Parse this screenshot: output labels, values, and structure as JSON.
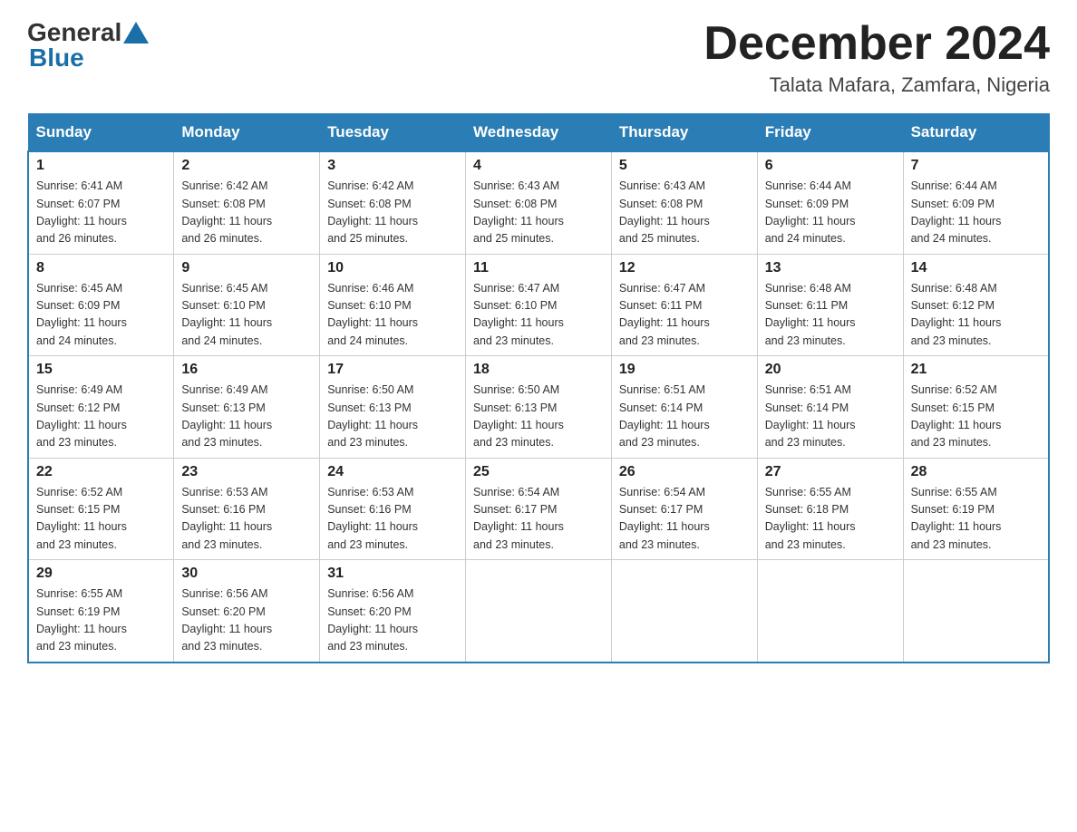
{
  "header": {
    "logo_general": "General",
    "logo_blue": "Blue",
    "month_title": "December 2024",
    "location": "Talata Mafara, Zamfara, Nigeria"
  },
  "weekdays": [
    "Sunday",
    "Monday",
    "Tuesday",
    "Wednesday",
    "Thursday",
    "Friday",
    "Saturday"
  ],
  "weeks": [
    [
      {
        "day": "1",
        "sunrise": "6:41 AM",
        "sunset": "6:07 PM",
        "daylight": "11 hours and 26 minutes."
      },
      {
        "day": "2",
        "sunrise": "6:42 AM",
        "sunset": "6:08 PM",
        "daylight": "11 hours and 26 minutes."
      },
      {
        "day": "3",
        "sunrise": "6:42 AM",
        "sunset": "6:08 PM",
        "daylight": "11 hours and 25 minutes."
      },
      {
        "day": "4",
        "sunrise": "6:43 AM",
        "sunset": "6:08 PM",
        "daylight": "11 hours and 25 minutes."
      },
      {
        "day": "5",
        "sunrise": "6:43 AM",
        "sunset": "6:08 PM",
        "daylight": "11 hours and 25 minutes."
      },
      {
        "day": "6",
        "sunrise": "6:44 AM",
        "sunset": "6:09 PM",
        "daylight": "11 hours and 24 minutes."
      },
      {
        "day": "7",
        "sunrise": "6:44 AM",
        "sunset": "6:09 PM",
        "daylight": "11 hours and 24 minutes."
      }
    ],
    [
      {
        "day": "8",
        "sunrise": "6:45 AM",
        "sunset": "6:09 PM",
        "daylight": "11 hours and 24 minutes."
      },
      {
        "day": "9",
        "sunrise": "6:45 AM",
        "sunset": "6:10 PM",
        "daylight": "11 hours and 24 minutes."
      },
      {
        "day": "10",
        "sunrise": "6:46 AM",
        "sunset": "6:10 PM",
        "daylight": "11 hours and 24 minutes."
      },
      {
        "day": "11",
        "sunrise": "6:47 AM",
        "sunset": "6:10 PM",
        "daylight": "11 hours and 23 minutes."
      },
      {
        "day": "12",
        "sunrise": "6:47 AM",
        "sunset": "6:11 PM",
        "daylight": "11 hours and 23 minutes."
      },
      {
        "day": "13",
        "sunrise": "6:48 AM",
        "sunset": "6:11 PM",
        "daylight": "11 hours and 23 minutes."
      },
      {
        "day": "14",
        "sunrise": "6:48 AM",
        "sunset": "6:12 PM",
        "daylight": "11 hours and 23 minutes."
      }
    ],
    [
      {
        "day": "15",
        "sunrise": "6:49 AM",
        "sunset": "6:12 PM",
        "daylight": "11 hours and 23 minutes."
      },
      {
        "day": "16",
        "sunrise": "6:49 AM",
        "sunset": "6:13 PM",
        "daylight": "11 hours and 23 minutes."
      },
      {
        "day": "17",
        "sunrise": "6:50 AM",
        "sunset": "6:13 PM",
        "daylight": "11 hours and 23 minutes."
      },
      {
        "day": "18",
        "sunrise": "6:50 AM",
        "sunset": "6:13 PM",
        "daylight": "11 hours and 23 minutes."
      },
      {
        "day": "19",
        "sunrise": "6:51 AM",
        "sunset": "6:14 PM",
        "daylight": "11 hours and 23 minutes."
      },
      {
        "day": "20",
        "sunrise": "6:51 AM",
        "sunset": "6:14 PM",
        "daylight": "11 hours and 23 minutes."
      },
      {
        "day": "21",
        "sunrise": "6:52 AM",
        "sunset": "6:15 PM",
        "daylight": "11 hours and 23 minutes."
      }
    ],
    [
      {
        "day": "22",
        "sunrise": "6:52 AM",
        "sunset": "6:15 PM",
        "daylight": "11 hours and 23 minutes."
      },
      {
        "day": "23",
        "sunrise": "6:53 AM",
        "sunset": "6:16 PM",
        "daylight": "11 hours and 23 minutes."
      },
      {
        "day": "24",
        "sunrise": "6:53 AM",
        "sunset": "6:16 PM",
        "daylight": "11 hours and 23 minutes."
      },
      {
        "day": "25",
        "sunrise": "6:54 AM",
        "sunset": "6:17 PM",
        "daylight": "11 hours and 23 minutes."
      },
      {
        "day": "26",
        "sunrise": "6:54 AM",
        "sunset": "6:17 PM",
        "daylight": "11 hours and 23 minutes."
      },
      {
        "day": "27",
        "sunrise": "6:55 AM",
        "sunset": "6:18 PM",
        "daylight": "11 hours and 23 minutes."
      },
      {
        "day": "28",
        "sunrise": "6:55 AM",
        "sunset": "6:19 PM",
        "daylight": "11 hours and 23 minutes."
      }
    ],
    [
      {
        "day": "29",
        "sunrise": "6:55 AM",
        "sunset": "6:19 PM",
        "daylight": "11 hours and 23 minutes."
      },
      {
        "day": "30",
        "sunrise": "6:56 AM",
        "sunset": "6:20 PM",
        "daylight": "11 hours and 23 minutes."
      },
      {
        "day": "31",
        "sunrise": "6:56 AM",
        "sunset": "6:20 PM",
        "daylight": "11 hours and 23 minutes."
      },
      null,
      null,
      null,
      null
    ]
  ],
  "labels": {
    "sunrise": "Sunrise:",
    "sunset": "Sunset:",
    "daylight": "Daylight:"
  }
}
